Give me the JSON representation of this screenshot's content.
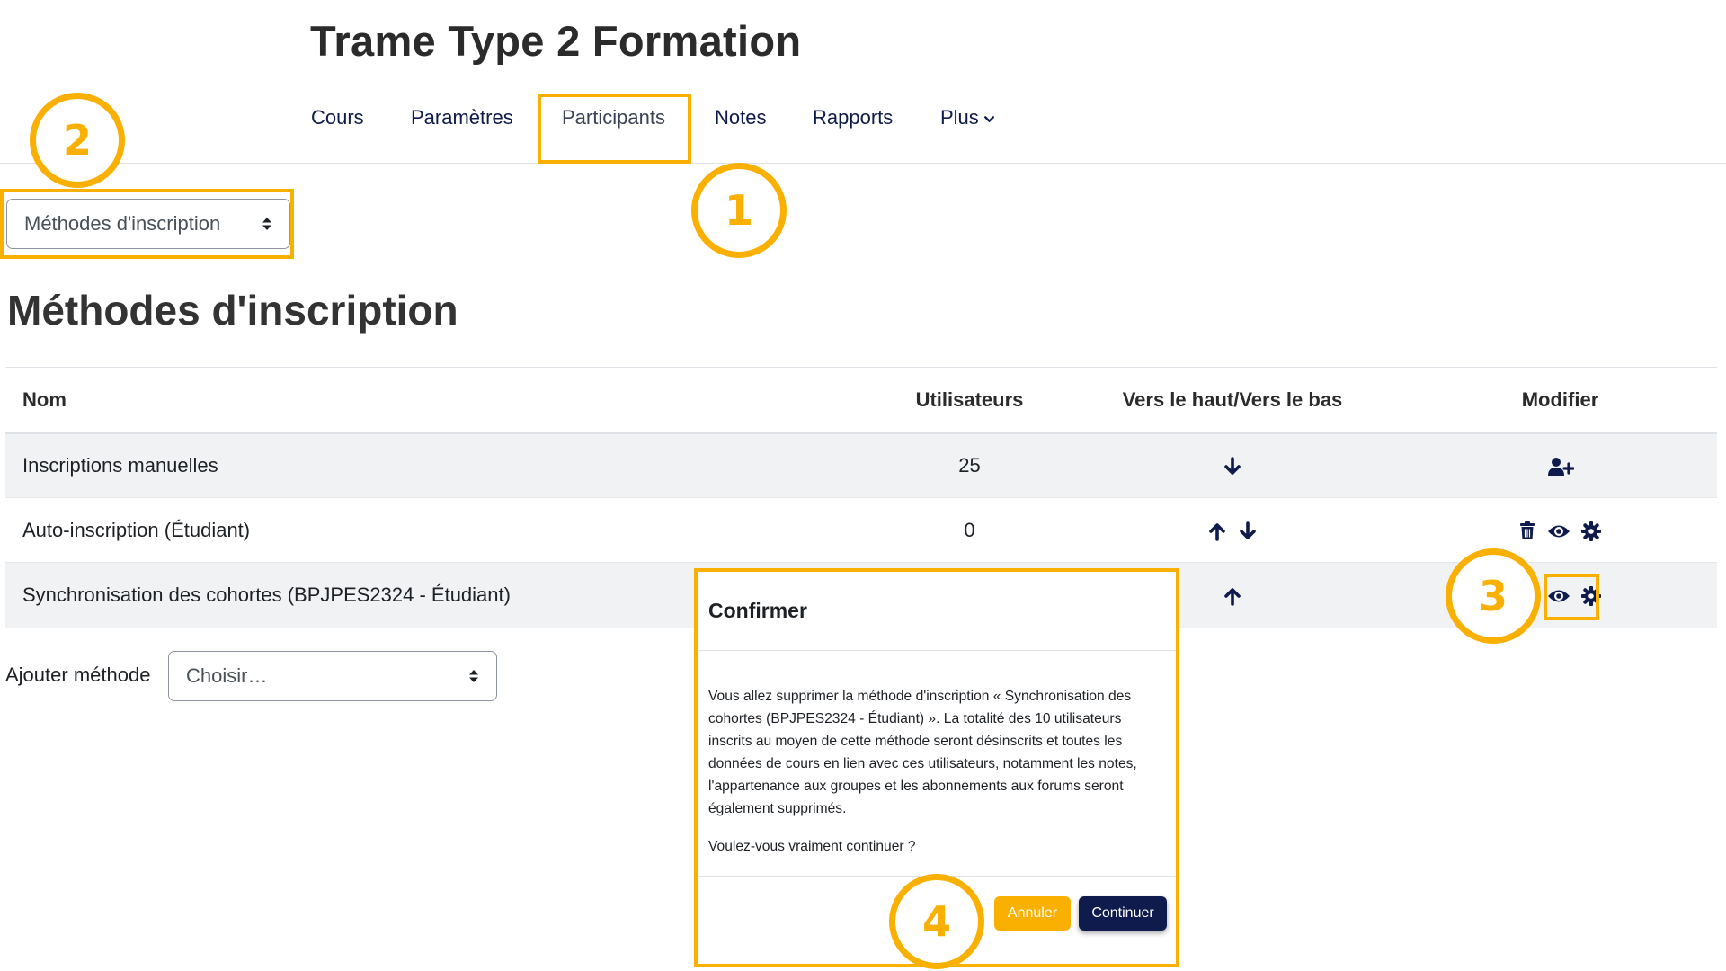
{
  "course": {
    "title": "Trame Type 2 Formation"
  },
  "nav": {
    "items": [
      {
        "label": "Cours"
      },
      {
        "label": "Paramètres"
      },
      {
        "label": "Participants"
      },
      {
        "label": "Notes"
      },
      {
        "label": "Rapports"
      },
      {
        "label": "Plus"
      }
    ]
  },
  "page_select": {
    "value": "Méthodes d'inscription"
  },
  "page": {
    "heading": "Méthodes d'inscription"
  },
  "table": {
    "headers": [
      "Nom",
      "Utilisateurs",
      "Vers le haut/Vers le bas",
      "Modifier"
    ],
    "rows": [
      {
        "name": "Inscriptions manuelles",
        "users": "25"
      },
      {
        "name": "Auto-inscription (Étudiant)",
        "users": "0"
      },
      {
        "name": "Synchronisation des cohortes (BPJPES2324 - Étudiant)",
        "users": ""
      }
    ]
  },
  "add_method": {
    "label": "Ajouter méthode",
    "select_value": "Choisir…"
  },
  "callouts": [
    "1",
    "2",
    "3",
    "4"
  ],
  "modal": {
    "title": "Confirmer",
    "message": "Vous allez supprimer la méthode d'inscription « Synchronisation des cohortes (BPJPES2324 - Étudiant) ». La totalité des 10 utilisateurs inscrits au moyen de cette méthode seront désinscrits et toutes les données de cours en lien avec ces utilisateurs, notamment les notes, l'appartenance aux groupes et les abonnements aux forums seront également supprimés.",
    "question": "Voulez-vous vraiment continuer ?",
    "cancel_label": "Annuler",
    "continue_label": "Continuer"
  },
  "colors": {
    "highlight": "#f9b000",
    "primary": "#0f1a4d",
    "icon": "#0f1b4a"
  }
}
